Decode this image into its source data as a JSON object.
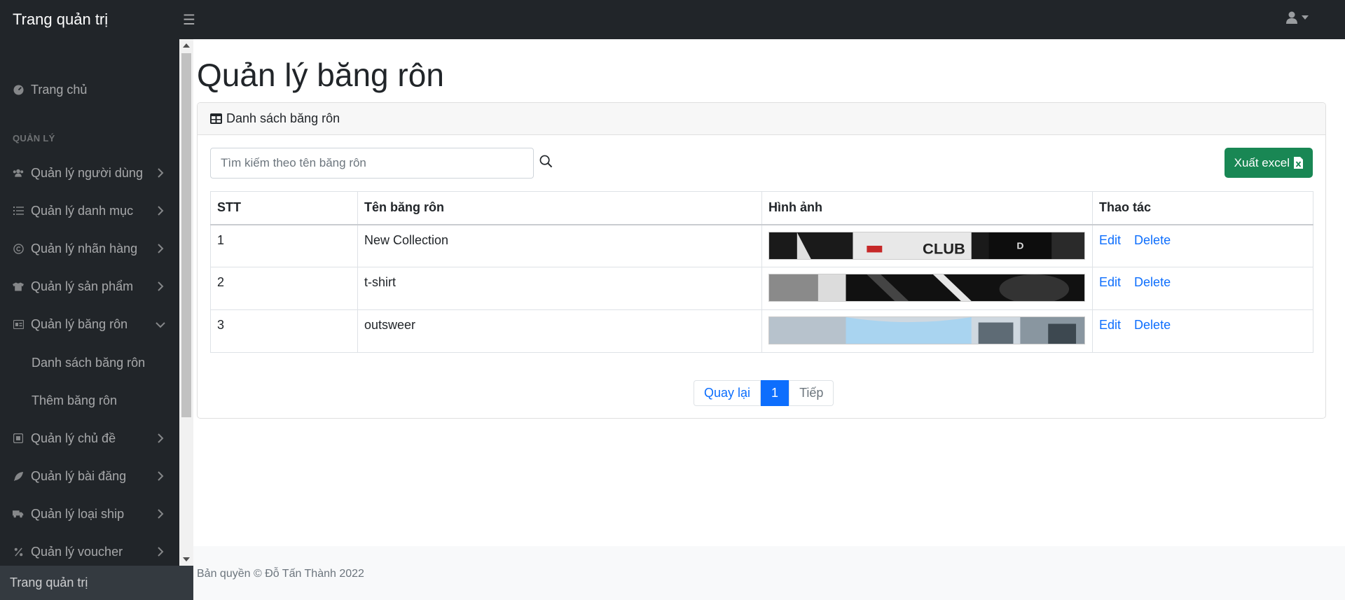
{
  "brand": "Trang quản trị",
  "sidebar": {
    "home": "Trang chủ",
    "heading": "QUẢN LÝ",
    "items": [
      {
        "label": "Quản lý người dùng",
        "icon": "users-icon"
      },
      {
        "label": "Quản lý danh mục",
        "icon": "list-icon"
      },
      {
        "label": "Quản lý nhãn hàng",
        "icon": "copyright-icon"
      },
      {
        "label": "Quản lý sản phẩm",
        "icon": "tshirt-icon"
      },
      {
        "label": "Quản lý băng rôn",
        "icon": "banner-icon",
        "expanded": true
      },
      {
        "label": "Quản lý chủ đề",
        "icon": "square-icon"
      },
      {
        "label": "Quản lý bài đăng",
        "icon": "feather-icon"
      },
      {
        "label": "Quản lý loại ship",
        "icon": "truck-icon"
      },
      {
        "label": "Quản lý voucher",
        "icon": "percent-icon"
      }
    ],
    "subitems": [
      "Danh sách băng rôn",
      "Thêm băng rôn"
    ],
    "footer": "Trang quản trị"
  },
  "main": {
    "title": "Quản lý băng rôn",
    "card_title": "Danh sách băng rôn",
    "search_placeholder": "Tìm kiếm theo tên băng rôn",
    "excel_label": "Xuất excel",
    "columns": [
      "STT",
      "Tên băng rôn",
      "Hình ảnh",
      "Thao tác"
    ],
    "rows": [
      {
        "stt": "1",
        "name": "New Collection"
      },
      {
        "stt": "2",
        "name": "t-shirt"
      },
      {
        "stt": "3",
        "name": "outsweer"
      }
    ],
    "edit_label": "Edit",
    "delete_label": "Delete",
    "pagination": {
      "prev": "Quay lại",
      "current": "1",
      "next": "Tiếp"
    }
  },
  "footer": "Bản quyền © Đỗ Tấn Thành 2022",
  "colors": {
    "sidebar": "#212529",
    "primary": "#0d6efd",
    "success": "#198754"
  }
}
